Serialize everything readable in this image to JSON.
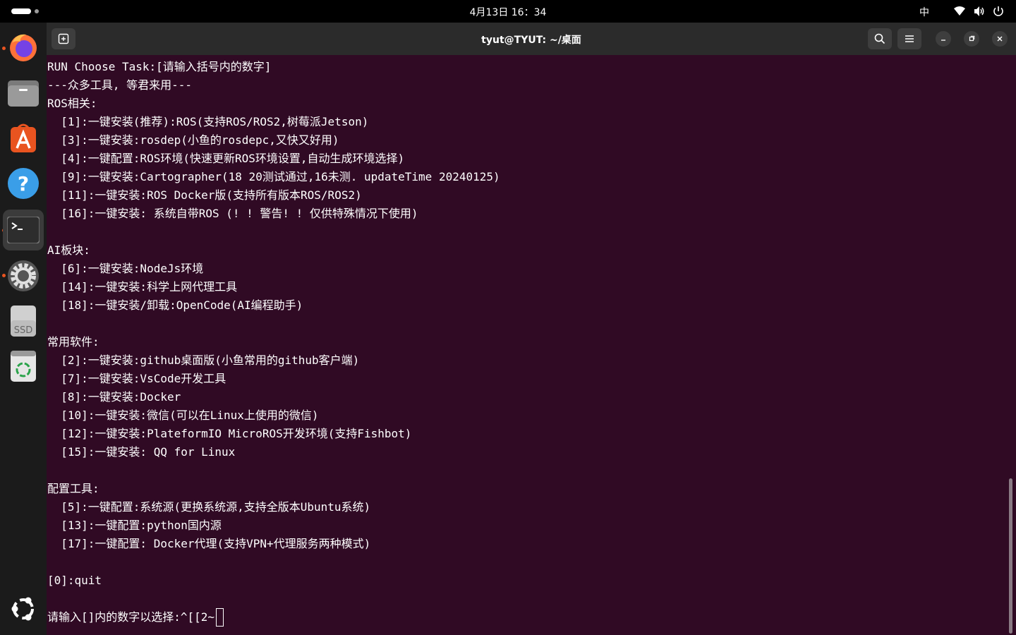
{
  "topbar": {
    "clock": "4月13日 16：34",
    "ime": "中",
    "icons": [
      "activities-pill",
      "wifi-icon",
      "volume-icon",
      "power-icon"
    ]
  },
  "dock": {
    "items": [
      {
        "name": "firefox-icon",
        "running": true
      },
      {
        "name": "files-icon",
        "running": false
      },
      {
        "name": "app-center-icon",
        "running": false
      },
      {
        "name": "help-icon",
        "running": false
      },
      {
        "name": "terminal-icon",
        "running": true,
        "active": true
      },
      {
        "name": "settings-icon",
        "running": true
      },
      {
        "name": "ssd-drive-icon",
        "label": "SSD",
        "running": false
      },
      {
        "name": "trash-icon",
        "running": false
      }
    ],
    "show_apps": "ubuntu-logo-icon"
  },
  "window": {
    "title": "tyut@TYUT: ~/桌面"
  },
  "terminal": {
    "lines": [
      "RUN Choose Task:[请输入括号内的数字]",
      "---众多工具, 等君来用---",
      "ROS相关:",
      "  [1]:一键安装(推荐):ROS(支持ROS/ROS2,树莓派Jetson)",
      "  [3]:一键安装:rosdep(小鱼的rosdepc,又快又好用)",
      "  [4]:一键配置:ROS环境(快速更新ROS环境设置,自动生成环境选择)",
      "  [9]:一键安装:Cartographer(18 20测试通过,16未测. updateTime 20240125)",
      "  [11]:一键安装:ROS Docker版(支持所有版本ROS/ROS2)",
      "  [16]:一键安装: 系统自带ROS (! ! 警告! ! 仅供特殊情况下使用)",
      "",
      "AI板块:",
      "  [6]:一键安装:NodeJs环境",
      "  [14]:一键安装:科学上网代理工具",
      "  [18]:一键安装/卸载:OpenCode(AI编程助手)",
      "",
      "常用软件:",
      "  [2]:一键安装:github桌面版(小鱼常用的github客户端)",
      "  [7]:一键安装:VsCode开发工具",
      "  [8]:一键安装:Docker",
      "  [10]:一键安装:微信(可以在Linux上使用的微信)",
      "  [12]:一键安装:PlateformIO MicroROS开发环境(支持Fishbot)",
      "  [15]:一键安装: QQ for Linux",
      "",
      "配置工具:",
      "  [5]:一键配置:系统源(更换系统源,支持全版本Ubuntu系统)",
      "  [13]:一键配置:python国内源",
      "  [17]:一键配置: Docker代理(支持VPN+代理服务两种模式)",
      "",
      "[0]:quit",
      ""
    ],
    "prompt": "请输入[]内的数字以选择:^[[2~"
  },
  "colors": {
    "terminal_bg": "#300a24",
    "titlebar_bg": "#2b2b2b",
    "dock_bg": "#1b1b1b",
    "accent": "#e95420"
  }
}
